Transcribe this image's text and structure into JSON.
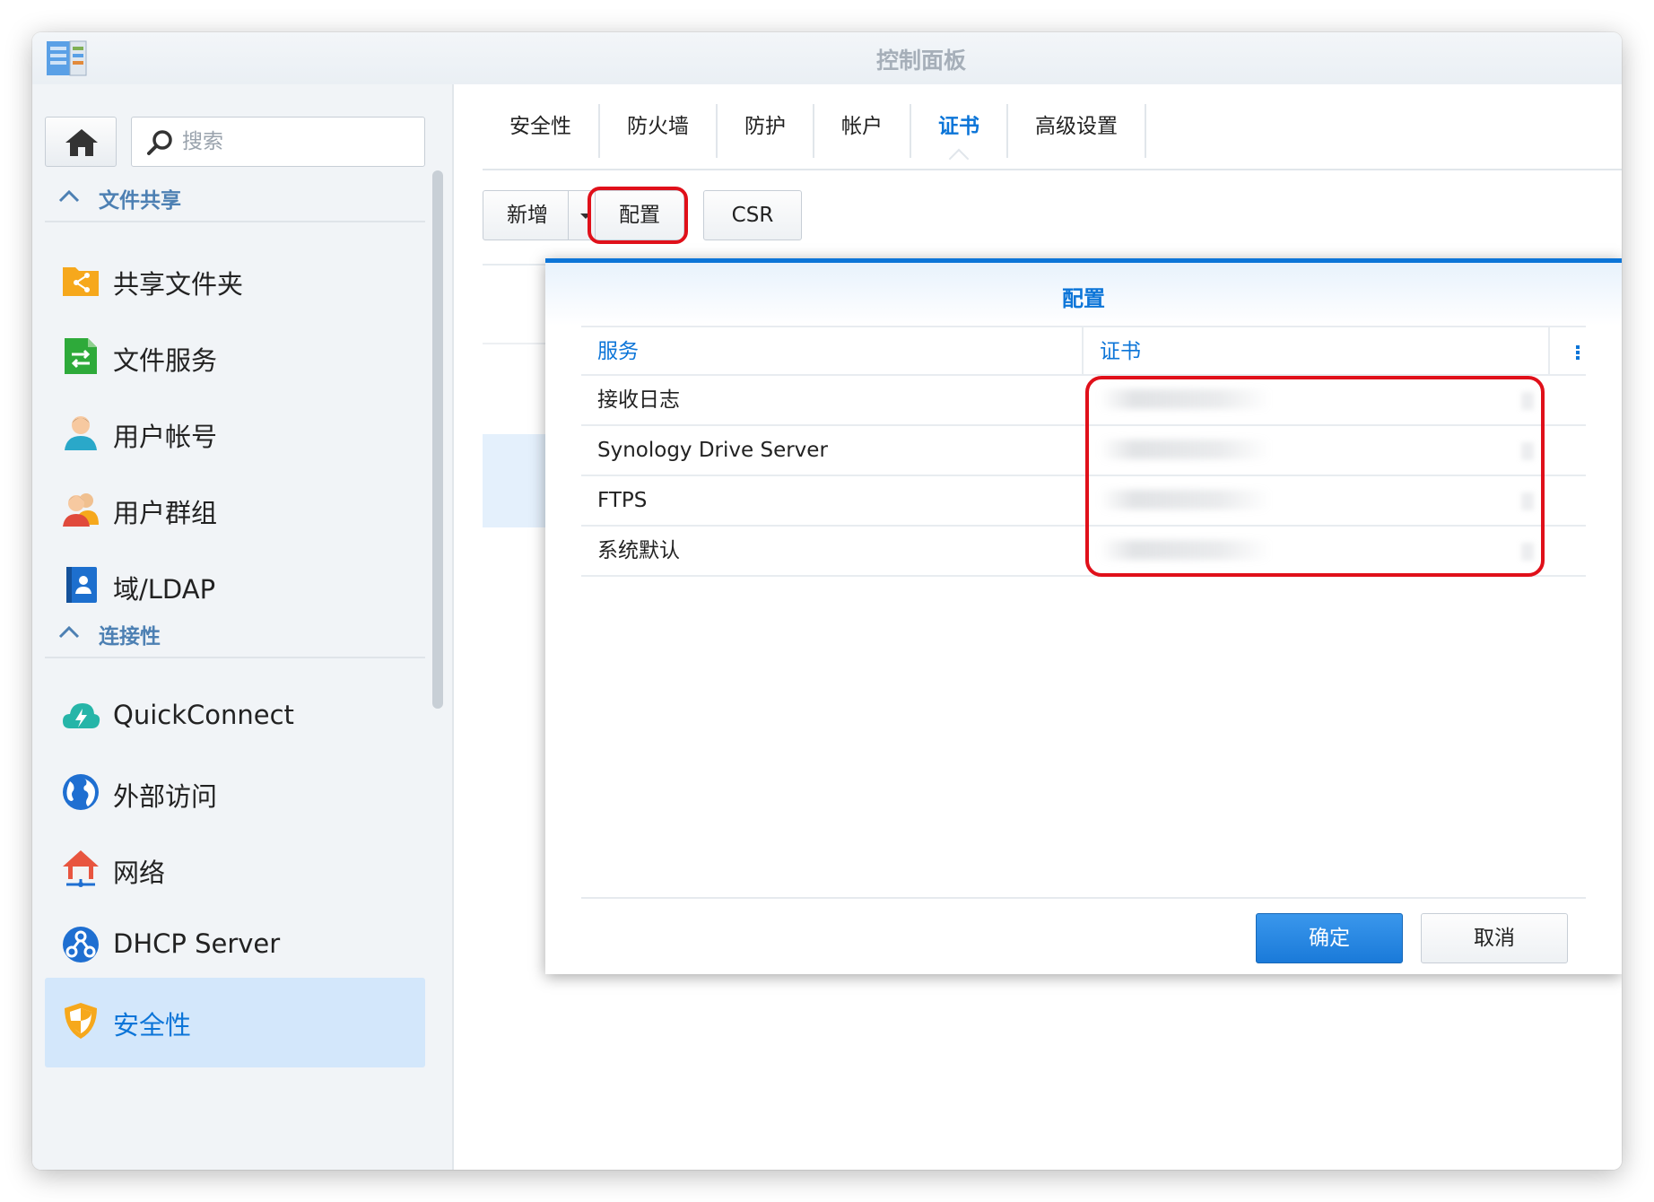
{
  "window": {
    "title": "控制面板"
  },
  "sidebar": {
    "search_placeholder": "搜索",
    "sections": [
      {
        "label": "文件共享"
      },
      {
        "label": "连接性"
      }
    ],
    "items": [
      {
        "label": "共享文件夹",
        "icon": "shared-folder-icon"
      },
      {
        "label": "文件服务",
        "icon": "file-services-icon"
      },
      {
        "label": "用户帐号",
        "icon": "user-icon"
      },
      {
        "label": "用户群组",
        "icon": "user-group-icon"
      },
      {
        "label": "域/LDAP",
        "icon": "domain-ldap-icon"
      },
      {
        "label": "QuickConnect",
        "icon": "quickconnect-cloud-icon"
      },
      {
        "label": "外部访问",
        "icon": "globe-icon"
      },
      {
        "label": "网络",
        "icon": "network-house-icon"
      },
      {
        "label": "DHCP Server",
        "icon": "dhcp-icon"
      },
      {
        "label": "安全性",
        "icon": "shield-icon",
        "active": true
      }
    ]
  },
  "tabs": [
    {
      "label": "安全性"
    },
    {
      "label": "防火墙"
    },
    {
      "label": "防护"
    },
    {
      "label": "帐户"
    },
    {
      "label": "证书",
      "active": true
    },
    {
      "label": "高级设置"
    }
  ],
  "toolbar": {
    "add_label": "新增",
    "configure_label": "配置",
    "csr_label": "CSR"
  },
  "dialog": {
    "title": "配置",
    "columns": [
      "服务",
      "证书"
    ],
    "rows": [
      {
        "service": "接收日志"
      },
      {
        "service": "Synology Drive Server"
      },
      {
        "service": "FTPS"
      },
      {
        "service": "系统默认"
      }
    ],
    "ok_label": "确定",
    "cancel_label": "取消"
  },
  "colors": {
    "accent": "#0c75d8",
    "highlight": "#e0101a",
    "active_item_bg": "#d3e7fb"
  }
}
